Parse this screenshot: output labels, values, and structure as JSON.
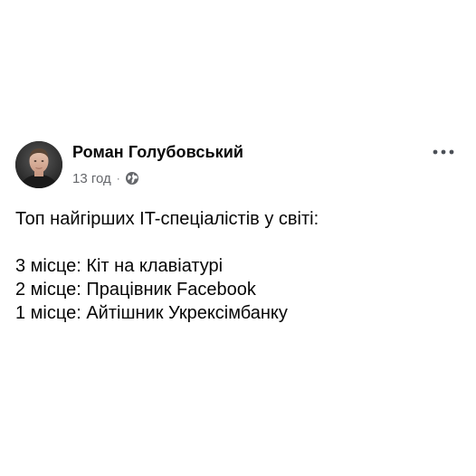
{
  "post": {
    "author": "Роман Голубовський",
    "time": "13 год",
    "separator": "·",
    "privacy_icon": "globe-icon",
    "more_icon": "more-horizontal-icon",
    "avatar_icon": "profile-photo",
    "lines": [
      "Топ найгірших IT-спеціалістів у світі:",
      "3 місце: Кіт на клавіатурі",
      "2 місце: Працівник Facebook",
      "1 місце: Айтішник Укрексімбанку"
    ]
  },
  "colors": {
    "text": "#050505",
    "secondary_text": "#65676b",
    "background": "#ffffff"
  }
}
